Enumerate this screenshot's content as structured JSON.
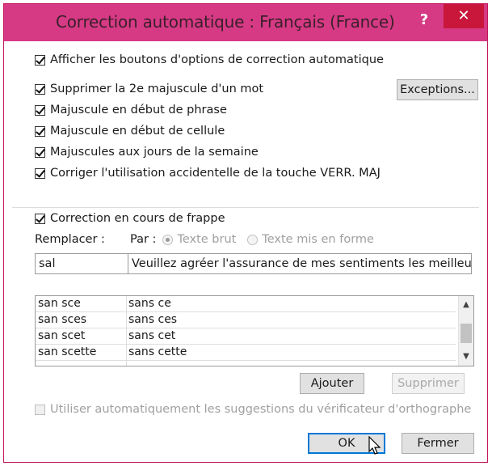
{
  "dialog": {
    "title": "Correction automatique : Français (France)",
    "help_label": "?",
    "close_label": "✕"
  },
  "options": {
    "show_buttons": "Afficher les boutons d'options de correction automatique",
    "two_initial_caps": "Supprimer la 2e majuscule d'un mot",
    "capitalize_sentence": "Majuscule en début de phrase",
    "capitalize_cell": "Majuscule en début de cellule",
    "capitalize_days": "Majuscules aux jours de la semaine",
    "caps_lock": "Corriger l'utilisation accidentelle de la touche VERR. MAJ",
    "replace_as_you_type": "Correction en cours de frappe",
    "use_spellchecker": "Utiliser automatiquement les suggestions du vérificateur d'orthographe"
  },
  "buttons": {
    "exceptions": "Exceptions...",
    "add": "Ajouter",
    "delete": "Supprimer",
    "ok": "OK",
    "close": "Fermer"
  },
  "replace": {
    "replace_label": "Remplacer :",
    "with_label": "Par :",
    "plain_text": "Texte brut",
    "formatted_text": "Texte mis en forme",
    "replace_value": "sal",
    "with_value": "Veuillez agréer l'assurance de mes sentiments les meilleurs"
  },
  "list": {
    "rows": [
      {
        "from": "san sce",
        "to": "sans ce"
      },
      {
        "from": "san sces",
        "to": "sans ces"
      },
      {
        "from": "san scet",
        "to": "sans cet"
      },
      {
        "from": "san scette",
        "to": "sans cette"
      }
    ]
  }
}
